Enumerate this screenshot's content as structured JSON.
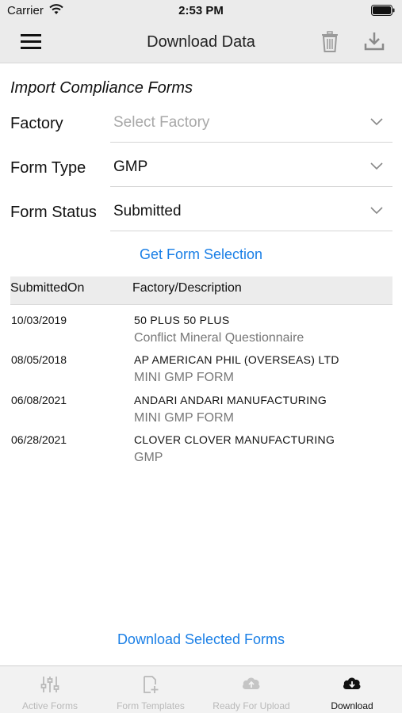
{
  "status_bar": {
    "carrier": "Carrier",
    "time": "2:53 PM"
  },
  "header": {
    "title": "Download Data"
  },
  "form": {
    "section_title": "Import Compliance Forms",
    "fields": [
      {
        "label": "Factory",
        "value": "Select Factory",
        "is_placeholder": true
      },
      {
        "label": "Form Type",
        "value": "GMP",
        "is_placeholder": false
      },
      {
        "label": "Form Status",
        "value": "Submitted",
        "is_placeholder": false
      }
    ],
    "get_selection_link": "Get Form Selection"
  },
  "table": {
    "columns": [
      "SubmittedOn",
      "Factory/Description"
    ],
    "rows": [
      {
        "date": "10/03/2019",
        "factory": "50 PLUS  50 PLUS",
        "description": "Conflict Mineral Questionnaire"
      },
      {
        "date": "08/05/2018",
        "factory": "AP  AMERICAN PHIL (OVERSEAS) LTD",
        "description": "MINI GMP FORM"
      },
      {
        "date": "06/08/2021",
        "factory": "ANDARI  ANDARI MANUFACTURING",
        "description": "MINI GMP FORM"
      },
      {
        "date": "06/28/2021",
        "factory": "CLOVER  CLOVER MANUFACTURING",
        "description": "GMP"
      }
    ]
  },
  "download_selected_link": "Download Selected Forms",
  "tab_bar": {
    "tabs": [
      {
        "label": "Active Forms",
        "icon": "sliders-icon",
        "active": false
      },
      {
        "label": "Form Templates",
        "icon": "add-document-icon",
        "active": false
      },
      {
        "label": "Ready For Upload",
        "icon": "cloud-upload-icon",
        "active": false
      },
      {
        "label": "Download",
        "icon": "cloud-download-icon",
        "active": true
      }
    ]
  },
  "colors": {
    "accent": "#1a7fe6",
    "nav_background": "#ebebeb",
    "tab_inactive": "#b9b9b9"
  }
}
